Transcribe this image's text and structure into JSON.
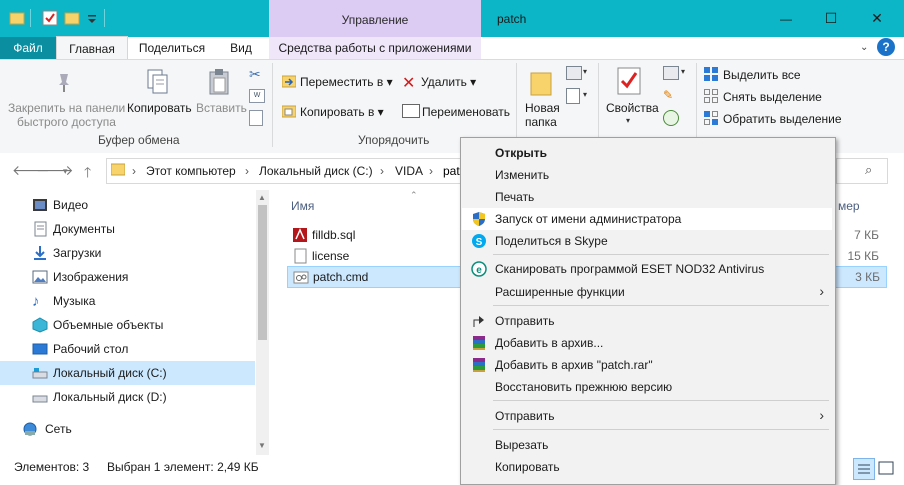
{
  "window": {
    "title": "patch",
    "context_tab_header": "Управление",
    "controls": {
      "minimize": "—",
      "maximize": "☐",
      "close": "✕"
    }
  },
  "ribbon": {
    "tabs": [
      "Файл",
      "Главная",
      "Поделиться",
      "Вид",
      "Средства работы с приложениями"
    ],
    "clipboard": {
      "pin_label_1": "Закрепить на панели",
      "pin_label_2": "быстрого доступа",
      "copy": "Копировать",
      "paste": "Вставить",
      "group": "Буфер обмена"
    },
    "organize": {
      "move_to": "Переместить в",
      "copy_to": "Копировать в",
      "delete": "Удалить",
      "rename": "Переименовать",
      "group": "Упорядочить"
    },
    "new": {
      "new_folder_1": "Новая",
      "new_folder_2": "папка"
    },
    "open": {
      "properties": "Свойства"
    },
    "select": {
      "select_all": "Выделить все",
      "select_none": "Снять выделение",
      "invert": "Обратить выделение"
    }
  },
  "address": {
    "crumbs": [
      "Этот компьютер",
      "Локальный диск (C:)",
      "VIDA",
      "patch"
    ]
  },
  "nav_pane": {
    "items": [
      {
        "label": "Видео",
        "icon": "video-folder-icon"
      },
      {
        "label": "Документы",
        "icon": "documents-folder-icon"
      },
      {
        "label": "Загрузки",
        "icon": "downloads-folder-icon"
      },
      {
        "label": "Изображения",
        "icon": "pictures-folder-icon"
      },
      {
        "label": "Музыка",
        "icon": "music-folder-icon"
      },
      {
        "label": "Объемные объекты",
        "icon": "3d-objects-icon"
      },
      {
        "label": "Рабочий стол",
        "icon": "desktop-folder-icon"
      },
      {
        "label": "Локальный диск (C:)",
        "icon": "drive-c-icon"
      },
      {
        "label": "Локальный диск (D:)",
        "icon": "drive-d-icon"
      },
      {
        "label": "Сеть",
        "icon": "network-icon"
      }
    ]
  },
  "file_list": {
    "col_name": "Имя",
    "col_size_partial": "мер",
    "files": [
      {
        "name": "filldb.sql",
        "size": "7 КБ",
        "icon": "sql-file-icon"
      },
      {
        "name": "license",
        "size": "15 КБ",
        "icon": "text-file-icon"
      },
      {
        "name": "patch.cmd",
        "size": "3 КБ",
        "icon": "cmd-file-icon"
      }
    ]
  },
  "status": {
    "count": "Элементов: 3",
    "selected": "Выбран 1 элемент: 2,49 КБ"
  },
  "context_menu": {
    "open": "Открыть",
    "edit": "Изменить",
    "print": "Печать",
    "run_as_admin": "Запуск от имени администратора",
    "share_skype": "Поделиться в Skype",
    "eset_scan": "Сканировать программой ESET NOD32 Antivirus",
    "advanced": "Расширенные функции",
    "send_share": "Отправить",
    "add_archive": "Добавить в архив...",
    "add_archive_rar": "Добавить в архив \"patch.rar\"",
    "restore_prev": "Восстановить прежнюю версию",
    "send_to": "Отправить",
    "cut": "Вырезать",
    "copy": "Копировать"
  },
  "colors": {
    "titlebar": "#0db6c7",
    "file_tab": "#0a8ea0",
    "context_tab": "#dccbf2",
    "selection": "#cce8ff"
  }
}
